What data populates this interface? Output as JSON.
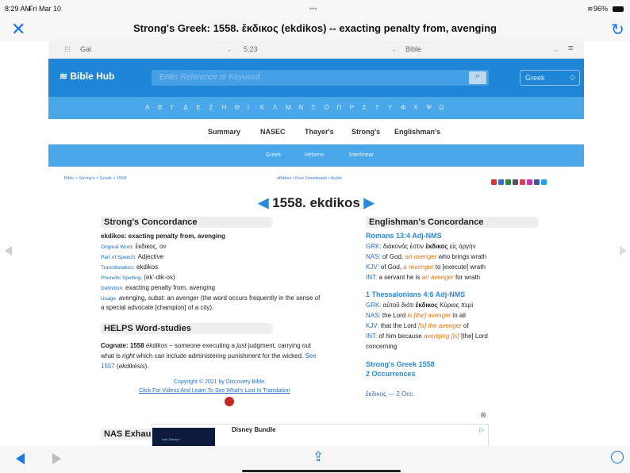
{
  "status": {
    "time": "8:29 AM",
    "date": "Fri Mar 10",
    "battery": "96%",
    "dots": "•••"
  },
  "titlebar": {
    "title": "Strong's Greek: 1558. ἔκδικος (ekdikos) -- exacting penalty from, avenging"
  },
  "selects": {
    "book": "Gal",
    "verse": "5:23",
    "version": "Bible",
    "menu_icon": "≡"
  },
  "header": {
    "logo": "Bible Hub",
    "search_placeholder": "Enter Reference or Keyword",
    "language": "Greek"
  },
  "greek_letters": [
    "Α",
    "Β",
    "Γ",
    "Δ",
    "Ε",
    "Ζ",
    "Η",
    "Θ",
    "Ι",
    "Κ",
    "Λ",
    "Μ",
    "Ν",
    "Ξ",
    "Ο",
    "Π",
    "Ρ",
    "Σ",
    "Τ",
    "Υ",
    "Φ",
    "Χ",
    "Ψ",
    "Ω"
  ],
  "tabs": [
    "Summary",
    "NASEC",
    "Thayer's",
    "Strong's",
    "Englishman's"
  ],
  "subtabs": [
    "Greek",
    "Hebrew",
    "Interlinear"
  ],
  "breadcrumb": "Bible > Strong's > Greek > 1558",
  "toplinks": "eBibles • Free Downloads • Audio",
  "heading": "1558. ekdikos",
  "strongs": {
    "title": "Strong's Concordance",
    "def_main": "ekdikos: exacting penalty from, avenging",
    "original_label": "Original Word:",
    "original": "ἔκδικος, ον",
    "pos_label": "Part of Speech:",
    "pos": "Adjective",
    "translit_label": "Transliteration:",
    "translit": "ekdikos",
    "phon_label": "Phonetic Spelling:",
    "phon": "(ek'-dik-os)",
    "defn_label": "Definition:",
    "defn": "exacting penalty from, avenging",
    "usage_label": "Usage:",
    "usage1": "avenging, subst: an avenger (the word occurs frequently in the sense of",
    "usage2": "a special advocate [champion] of a city)."
  },
  "helps": {
    "title": "HELPS Word-studies",
    "l1a": "Cognate: 1558 ",
    "l1b": "ékdikos",
    "l1c": " – someone executing a ",
    "l1d": "just",
    "l1e": " judgment, carrying out",
    "l2a": "what is ",
    "l2b": "right",
    "l2c": " which can include administering punishment for the wicked. ",
    "l2d": "See",
    "l3a": "1557",
    "l3b": " (",
    "l3c": "ekdikēsis",
    "l3d": ")."
  },
  "copyright": {
    "line1": "Copyright © 2021 by Discovery Bible.",
    "line2": "Click For Videos And Learn To See What's Lost In Translation"
  },
  "englishman": {
    "title": "Englishman's Concordance",
    "r1": "Romans 13:4 Adj-NMS",
    "r1_grk_a": "GRK: ",
    "r1_grk_b": "διάκονός ἐστιν ",
    "r1_grk_c": "ἔκδικος",
    "r1_grk_d": " εἰς ὀργὴν",
    "r1_nas_a": "NAS: ",
    "r1_nas_b": "of God, ",
    "r1_nas_c": "an avenger",
    "r1_nas_d": " who brings wrath",
    "r1_kjv_a": "KJV: ",
    "r1_kjv_b": "of God, ",
    "r1_kjv_c": "a revenger",
    "r1_kjv_d": " to [execute] wrath",
    "r1_int_a": "INT: ",
    "r1_int_b": "a servant he is ",
    "r1_int_c": "an avenger",
    "r1_int_d": " for wrath",
    "r2": "1 Thessalonians 4:6 Adj-NMS",
    "r2_grk_a": "GRK: ",
    "r2_grk_b": "αὐτοῦ διότι ",
    "r2_grk_c": "ἔκδικος",
    "r2_grk_d": " Κύριος περὶ",
    "r2_nas_a": "NAS: ",
    "r2_nas_b": "the Lord ",
    "r2_nas_c": "is [the] avenger",
    "r2_nas_d": " in all",
    "r2_kjv_a": "KJV: ",
    "r2_kjv_b": "that the Lord ",
    "r2_kjv_c": "[is] the avenger",
    "r2_kjv_d": " of",
    "r2_int_a": "INT: ",
    "r2_int_b": "of him because ",
    "r2_int_c": "avenging [is]",
    "r2_int_d": " [the] Lord",
    "r2_int_e": "concerning",
    "sg": "Strong's Greek 1558",
    "occ": "2 Occurrences",
    "occ_word": "ἔκδικος — 2 Occ."
  },
  "nas_partial": "NAS Exhau",
  "ad": {
    "title": "Disney Bundle",
    "brand": "hulu Disney+"
  },
  "colors": {
    "accent": "#1a73e8",
    "header": "#1f85d7",
    "bar": "#4aa7ea",
    "orange": "#e5730e"
  }
}
